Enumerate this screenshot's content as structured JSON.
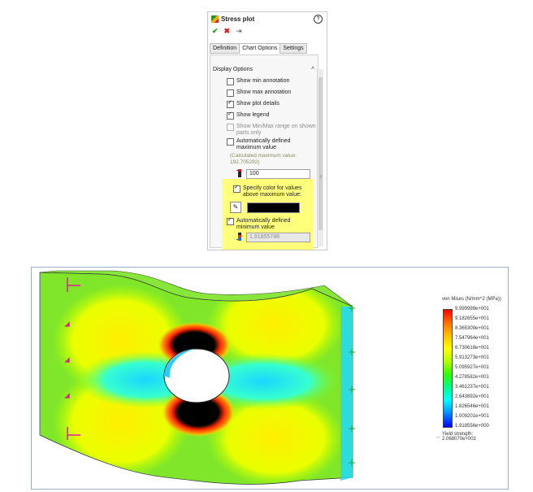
{
  "panel": {
    "title": "Stress plot",
    "help": "?",
    "actions": {
      "ok": "✔",
      "cancel": "✖",
      "pin": "⇥"
    },
    "tabs": [
      {
        "label": "Definition"
      },
      {
        "label": "Chart Options"
      },
      {
        "label": "Settings"
      }
    ],
    "section": "Display Options",
    "caret": "˄",
    "options": [
      {
        "label": "Show min annotation",
        "checked": false
      },
      {
        "label": "Show max annotation",
        "checked": false
      },
      {
        "label": "Show plot details",
        "checked": true
      },
      {
        "label": "Show legend",
        "checked": true
      },
      {
        "label": "Show Min/Max range on shown parts only",
        "checked": false,
        "disabled": true
      },
      {
        "label": "Automatically defined maximum value",
        "checked": false
      },
      {
        "label": "Specify color for values above maximum value:",
        "checked": true
      },
      {
        "label": "Automatically defined minimum value",
        "checked": true
      }
    ],
    "calc_max": "(Calculated maximum value: 192.705292)",
    "max_value": "100",
    "min_value": "1.91855788",
    "above_max_color": "#000000",
    "grip": "≡"
  },
  "legend": {
    "title": "von Mises (N/mm^2 (MPa))",
    "ticks": [
      "9.999999e+001",
      "9.182655e+001",
      "8.365309e+001",
      "7.547964e+001",
      "6.730618e+001",
      "5.913273e+001",
      "5.095927e+001",
      "4.278582e+001",
      "3.461237e+001",
      "2.643892e+001",
      "1.826546e+001",
      "1.009201e+001",
      "1.918556e+000"
    ],
    "yield": "Yield strength: 2.068070e+002",
    "yield_arrow": "→"
  },
  "colors": {
    "accent": "#ffff7c",
    "yield_arrow": "#e0285a"
  }
}
